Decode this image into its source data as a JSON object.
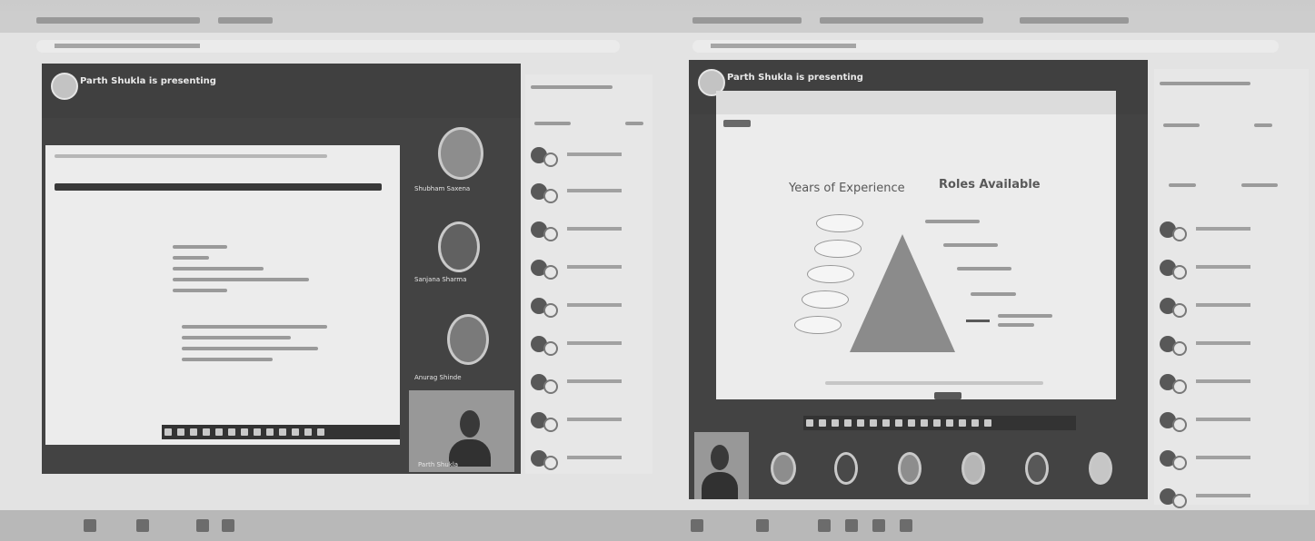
{
  "left_meeting": {
    "presenter_banner": "Parth Shukla is presenting",
    "participants": [
      {
        "name": "Shubham Saxena"
      },
      {
        "name": "Sanjana Sharma"
      },
      {
        "name": "Anurag Shinde"
      },
      {
        "name": "Parth Shukla"
      }
    ]
  },
  "right_meeting": {
    "presenter_banner": "Parth Shukla is presenting",
    "slide": {
      "left_heading": "Years of Experience",
      "right_heading": "Roles Available"
    }
  }
}
